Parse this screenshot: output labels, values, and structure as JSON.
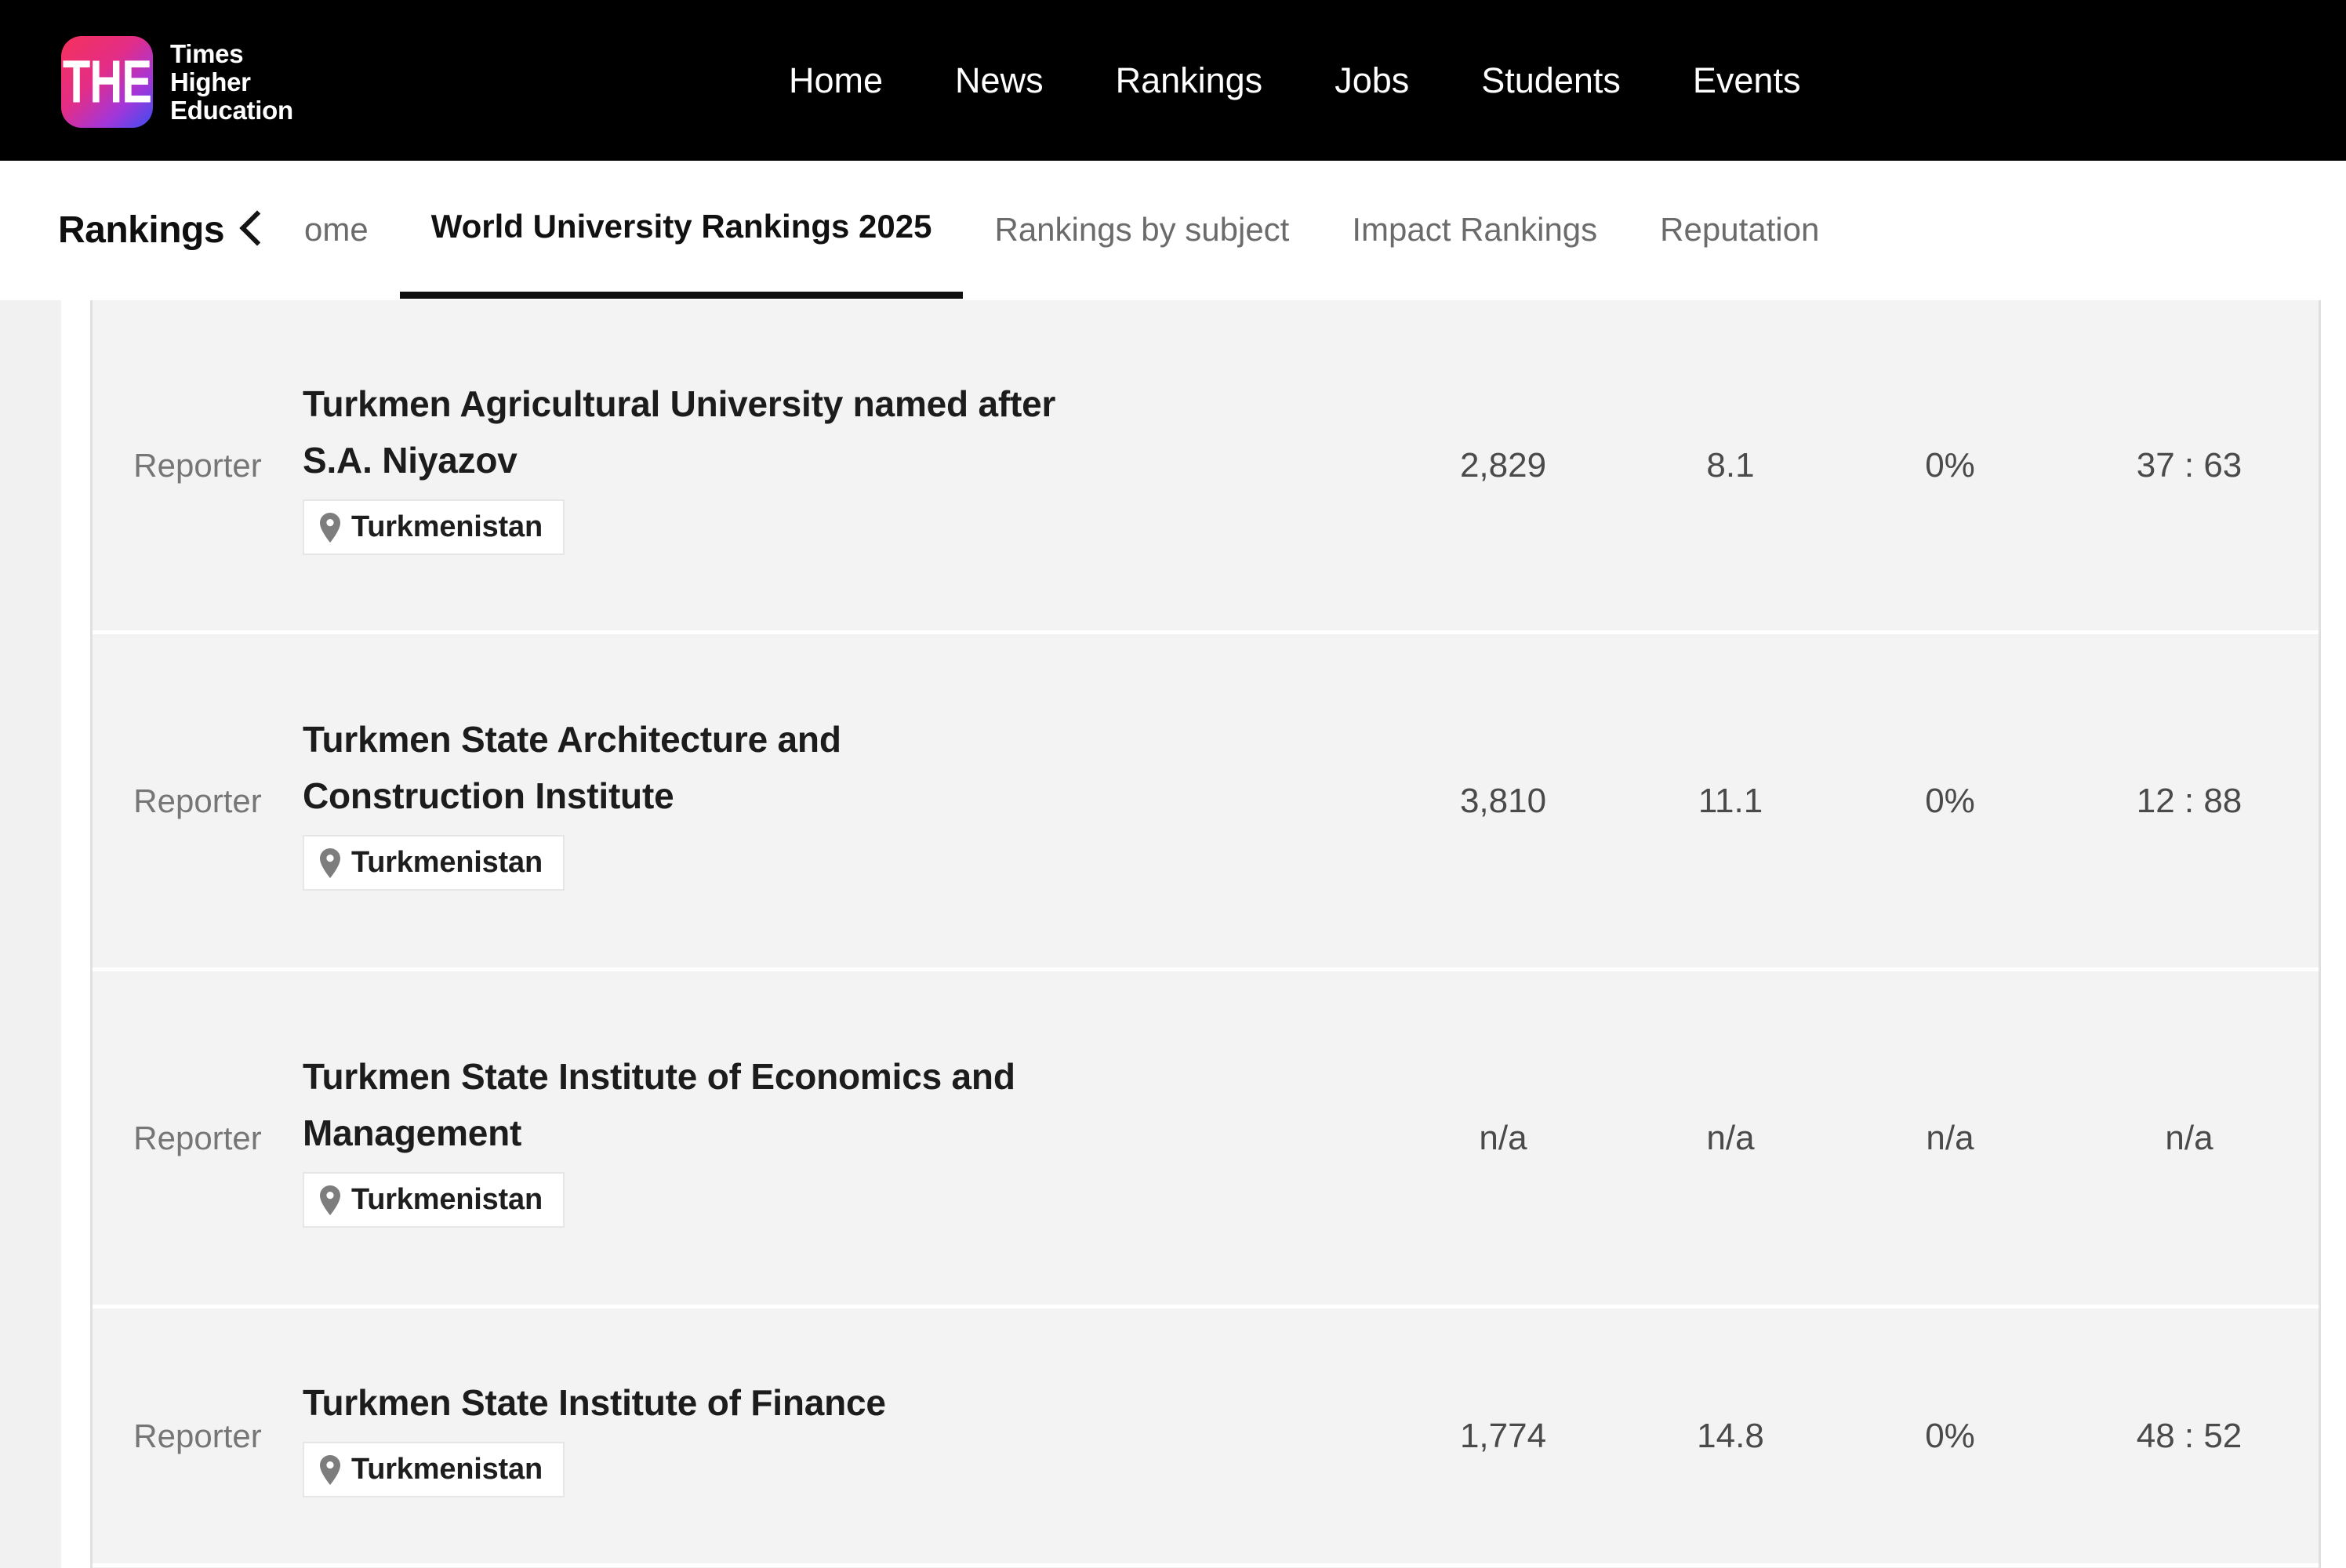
{
  "brand": {
    "mark_text": "THE",
    "name_line1": "Times",
    "name_line2": "Higher",
    "name_line3": "Education"
  },
  "main_nav": [
    {
      "label": "Home"
    },
    {
      "label": "News"
    },
    {
      "label": "Rankings"
    },
    {
      "label": "Jobs"
    },
    {
      "label": "Students"
    },
    {
      "label": "Events"
    }
  ],
  "subnav": {
    "section_title": "Rankings",
    "back_icon": "chevron-left-icon",
    "tabs": [
      {
        "label": "ome",
        "active": false,
        "clipped": true
      },
      {
        "label": "World University Rankings 2025",
        "active": true,
        "clipped": false
      },
      {
        "label": "Rankings by subject",
        "active": false,
        "clipped": false
      },
      {
        "label": "Impact Rankings",
        "active": false,
        "clipped": false
      },
      {
        "label": "Reputation",
        "active": false,
        "clipped": false
      }
    ]
  },
  "table": {
    "rows": [
      {
        "reporter": "Reporter",
        "name": "Turkmen Agricultural University named after S.A. Niyazov",
        "country": "Turkmenistan",
        "pin_icon": "map-pin-icon",
        "students": "2,829",
        "ratio": "8.1",
        "international": "0%",
        "gender": "37 : 63"
      },
      {
        "reporter": "Reporter",
        "name": "Turkmen State Architecture and Construction Institute",
        "country": "Turkmenistan",
        "pin_icon": "map-pin-icon",
        "students": "3,810",
        "ratio": "11.1",
        "international": "0%",
        "gender": "12 : 88"
      },
      {
        "reporter": "Reporter",
        "name": "Turkmen State Institute of Economics and Management",
        "country": "Turkmenistan",
        "pin_icon": "map-pin-icon",
        "students": "n/a",
        "ratio": "n/a",
        "international": "n/a",
        "gender": "n/a"
      },
      {
        "reporter": "Reporter",
        "name": "Turkmen State Institute of Finance",
        "country": "Turkmenistan",
        "pin_icon": "map-pin-icon",
        "students": "1,774",
        "ratio": "14.8",
        "international": "0%",
        "gender": "48 : 52"
      }
    ]
  },
  "colors": {
    "masthead_bg": "#000000",
    "row_bg": "#f3f3f3",
    "accent_underline": "#111111"
  }
}
